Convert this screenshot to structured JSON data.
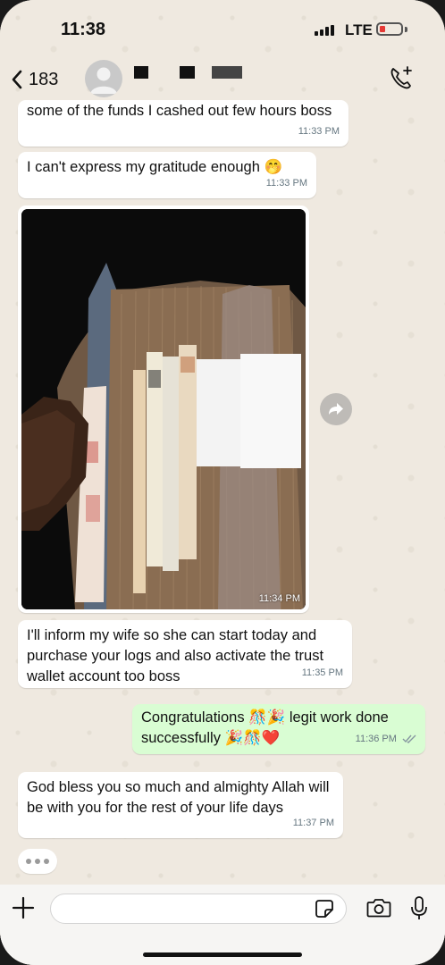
{
  "status_bar": {
    "time": "11:38",
    "network": "LTE"
  },
  "header": {
    "back_count": "183"
  },
  "messages": [
    {
      "text": "some of the funds I cashed out few hours boss",
      "time": "11:33 PM"
    },
    {
      "text": "I can't express my gratitude enough 🤭",
      "time": "11:33 PM"
    },
    {
      "time": "11:34 PM"
    },
    {
      "text": "I'll inform my wife so she can start today and purchase your logs and also activate the trust wallet account too boss",
      "time": "11:35 PM"
    },
    {
      "text": "Congratulations 🎊🎉 legit work done successfully 🎉🎊❤️",
      "time": "11:36 PM"
    },
    {
      "text": "God bless you so much and almighty Allah will be with you for the rest of your life days",
      "time": "11:37 PM"
    }
  ],
  "colors": {
    "outgoing_bubble": "#d9fdd3",
    "incoming_bubble": "#ffffff",
    "read_ticks": "#8696a0"
  }
}
